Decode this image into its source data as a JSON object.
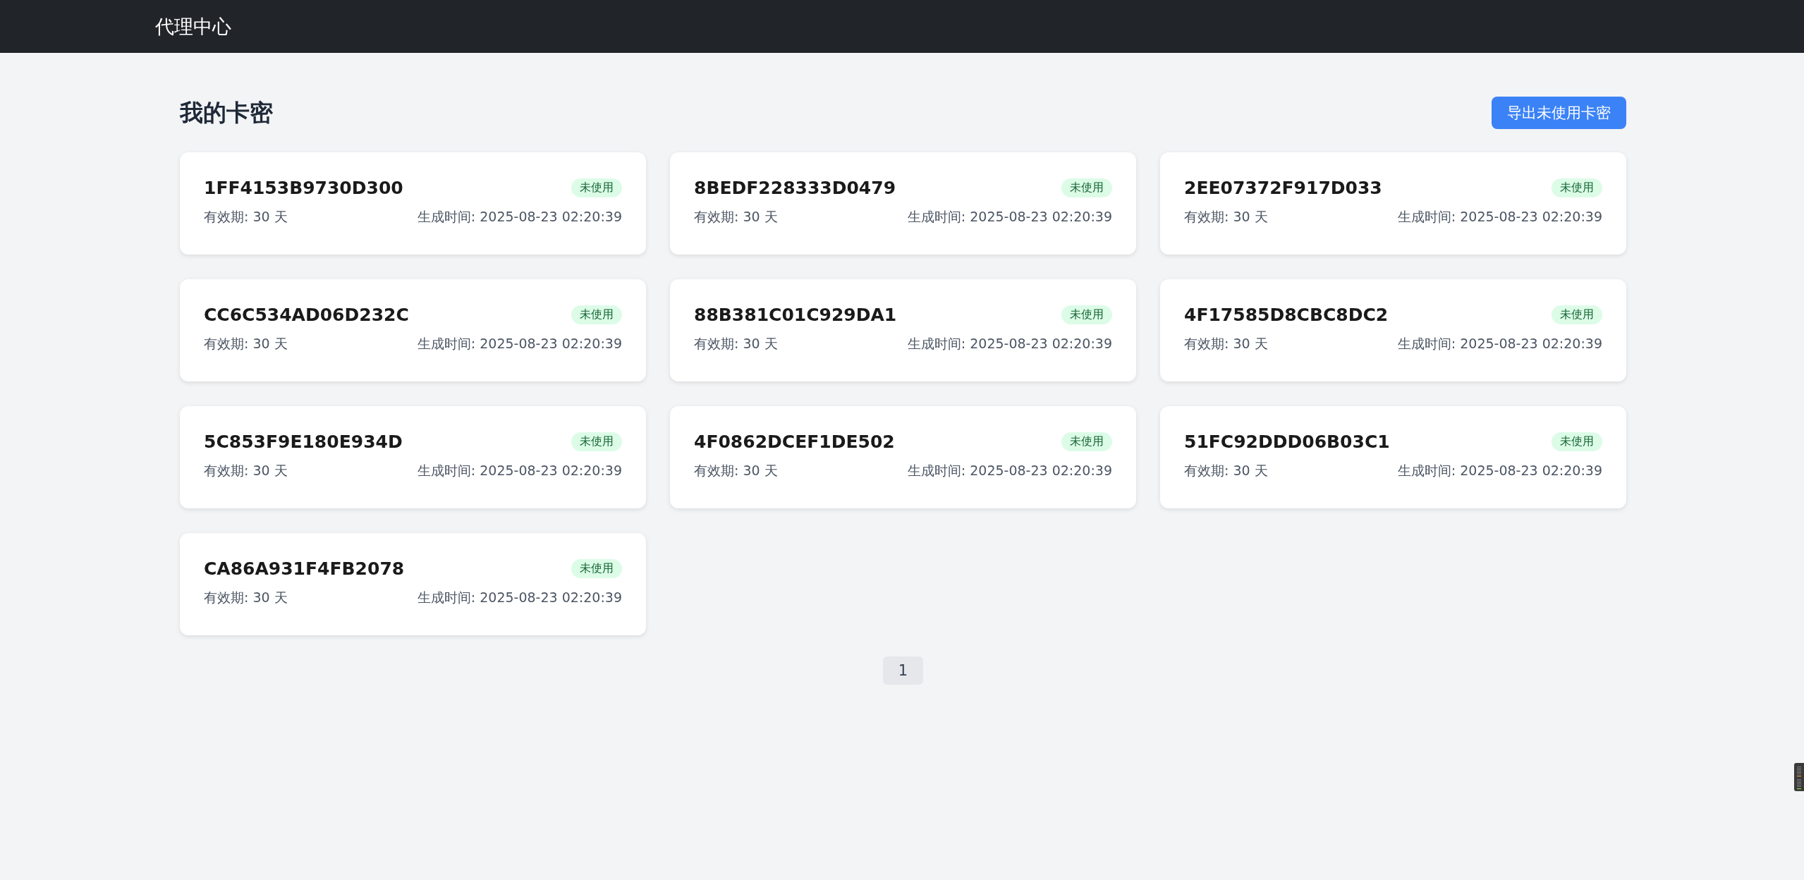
{
  "navbar": {
    "brand": "代理中心"
  },
  "page": {
    "title": "我的卡密",
    "export_button": "导出未使用卡密"
  },
  "cards": [
    {
      "code": "1FF4153B9730D300",
      "status": "未使用",
      "validity": "有效期: 30 天",
      "created": "生成时间: 2025-08-23 02:20:39"
    },
    {
      "code": "8BEDF228333D0479",
      "status": "未使用",
      "validity": "有效期: 30 天",
      "created": "生成时间: 2025-08-23 02:20:39"
    },
    {
      "code": "2EE07372F917D033",
      "status": "未使用",
      "validity": "有效期: 30 天",
      "created": "生成时间: 2025-08-23 02:20:39"
    },
    {
      "code": "CC6C534AD06D232C",
      "status": "未使用",
      "validity": "有效期: 30 天",
      "created": "生成时间: 2025-08-23 02:20:39"
    },
    {
      "code": "88B381C01C929DA1",
      "status": "未使用",
      "validity": "有效期: 30 天",
      "created": "生成时间: 2025-08-23 02:20:39"
    },
    {
      "code": "4F17585D8CBC8DC2",
      "status": "未使用",
      "validity": "有效期: 30 天",
      "created": "生成时间: 2025-08-23 02:20:39"
    },
    {
      "code": "5C853F9E180E934D",
      "status": "未使用",
      "validity": "有效期: 30 天",
      "created": "生成时间: 2025-08-23 02:20:39"
    },
    {
      "code": "4F0862DCEF1DE502",
      "status": "未使用",
      "validity": "有效期: 30 天",
      "created": "生成时间: 2025-08-23 02:20:39"
    },
    {
      "code": "51FC92DDD06B03C1",
      "status": "未使用",
      "validity": "有效期: 30 天",
      "created": "生成时间: 2025-08-23 02:20:39"
    },
    {
      "code": "CA86A931F4FB2078",
      "status": "未使用",
      "validity": "有效期: 30 天",
      "created": "生成时间: 2025-08-23 02:20:39"
    }
  ],
  "pagination": [
    {
      "label": "1",
      "selected": true
    }
  ]
}
